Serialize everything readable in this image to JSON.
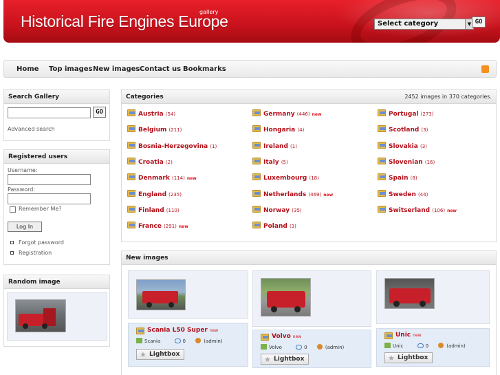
{
  "header": {
    "title": "Historical Fire Engines Europe",
    "subtitle": "gallery",
    "category_select": "Select category",
    "go_label": "GO"
  },
  "nav": {
    "items": [
      "Home",
      "Top images",
      "New images",
      "Contact us",
      "Bookmarks"
    ]
  },
  "search": {
    "heading": "Search Gallery",
    "go_label": "GO",
    "advanced": "Advanced search"
  },
  "users": {
    "heading": "Registered users",
    "username_label": "Username:",
    "password_label": "Password:",
    "remember": "Remember Me?",
    "login": "Log In",
    "forgot": "Forgot password",
    "registration": "Registration"
  },
  "random": {
    "heading": "Random image"
  },
  "categories": {
    "heading": "Categories",
    "summary": "2452 images in 370 categories.",
    "col1": [
      {
        "name": "Austria",
        "count": "(54)",
        "new": ""
      },
      {
        "name": "Belgium",
        "count": "(211)",
        "new": ""
      },
      {
        "name": "Bosnia-Herzegovina",
        "count": "(1)",
        "new": ""
      },
      {
        "name": "Croatia",
        "count": "(2)",
        "new": ""
      },
      {
        "name": "Denmark",
        "count": "(114)",
        "new": "new"
      },
      {
        "name": "England",
        "count": "(235)",
        "new": ""
      },
      {
        "name": "Finland",
        "count": "(110)",
        "new": ""
      },
      {
        "name": "France",
        "count": "(291)",
        "new": "new"
      }
    ],
    "col2": [
      {
        "name": "Germany",
        "count": "(446)",
        "new": "new"
      },
      {
        "name": "Hongaria",
        "count": "(4)",
        "new": ""
      },
      {
        "name": "Ireland",
        "count": "(1)",
        "new": ""
      },
      {
        "name": "Italy",
        "count": "(5)",
        "new": ""
      },
      {
        "name": "Luxembourg",
        "count": "(18)",
        "new": ""
      },
      {
        "name": "Netherlands",
        "count": "(469)",
        "new": "new"
      },
      {
        "name": "Norway",
        "count": "(35)",
        "new": ""
      },
      {
        "name": "Poland",
        "count": "(3)",
        "new": ""
      }
    ],
    "col3": [
      {
        "name": "Portugal",
        "count": "(273)",
        "new": ""
      },
      {
        "name": "Scotland",
        "count": "(3)",
        "new": ""
      },
      {
        "name": "Slovakia",
        "count": "(3)",
        "new": ""
      },
      {
        "name": "Slovenian",
        "count": "(16)",
        "new": ""
      },
      {
        "name": "Spain",
        "count": "(8)",
        "new": ""
      },
      {
        "name": "Sweden",
        "count": "(44)",
        "new": ""
      },
      {
        "name": "Switserland",
        "count": "(106)",
        "new": "new"
      }
    ]
  },
  "new_images": {
    "heading": "New images",
    "items": [
      {
        "title": "Scania L50 Super",
        "new": "new",
        "category": "Scania",
        "comments": "0",
        "user": "(admin)",
        "lightbox": "Lightbox"
      },
      {
        "title": "Volvo",
        "new": "new",
        "category": "Volvo",
        "comments": "0",
        "user": "(admin)",
        "lightbox": "Lightbox"
      },
      {
        "title": "Unic",
        "new": "new",
        "category": "Unic",
        "comments": "0",
        "user": "(admin)",
        "lightbox": "Lightbox"
      }
    ]
  },
  "colors": {
    "brand_red": "#c8121c",
    "link_red": "#b3101a"
  }
}
